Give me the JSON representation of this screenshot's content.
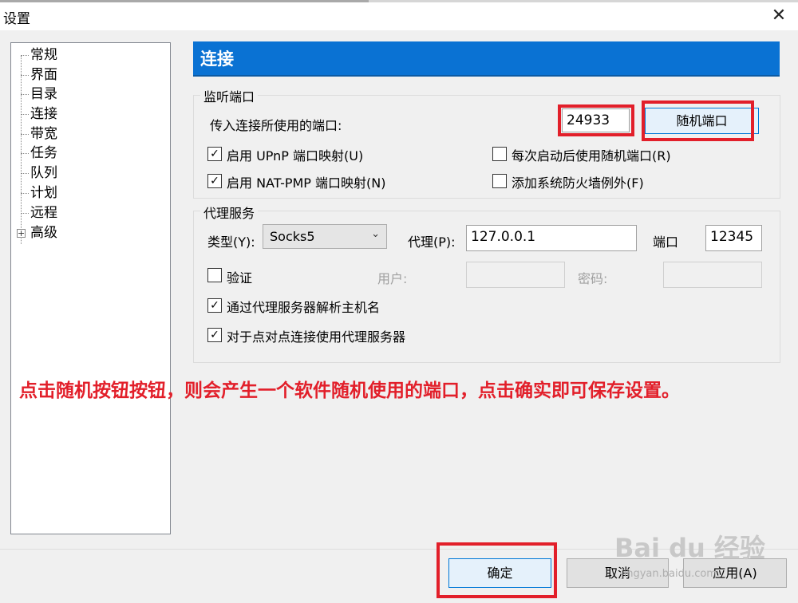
{
  "window": {
    "title": "设置",
    "close_glyph": "✕"
  },
  "sidebar": {
    "items": [
      {
        "label": "常规"
      },
      {
        "label": "界面"
      },
      {
        "label": "目录"
      },
      {
        "label": "连接"
      },
      {
        "label": "带宽"
      },
      {
        "label": "任务"
      },
      {
        "label": "队列"
      },
      {
        "label": "计划"
      },
      {
        "label": "远程"
      },
      {
        "label": "高级",
        "expander": "+"
      }
    ]
  },
  "header": {
    "title": "连接"
  },
  "listen_port": {
    "group_label": "监听端口",
    "incoming_label": "传入连接所使用的端口:",
    "port_value": "24933",
    "random_button": "随机端口",
    "upnp": {
      "label": "启用 UPnP 端口映射(U)",
      "checked": true
    },
    "natpmp": {
      "label": "启用 NAT-PMP 端口映射(N)",
      "checked": true
    },
    "random_each_start": {
      "label": "每次启动后使用随机端口(R)",
      "checked": false
    },
    "firewall": {
      "label": "添加系统防火墙例外(F)",
      "checked": false
    }
  },
  "proxy": {
    "group_label": "代理服务",
    "type_label": "类型(Y):",
    "type_value": "Socks5",
    "proxy_label": "代理(P):",
    "proxy_value": "127.0.0.1",
    "port_label": "端口",
    "port_value": "12345",
    "auth": {
      "label": "验证",
      "checked": false
    },
    "user_label": "用户:",
    "password_label": "密码:",
    "resolve_hostname": {
      "label": "通过代理服务器解析主机名",
      "checked": true
    },
    "p2p_proxy": {
      "label": "对于点对点连接使用代理服务器",
      "checked": true
    }
  },
  "annotation": "点击随机按钮按钮，则会产生一个软件随机使用的端口，点击确实即可保存设置。",
  "footer": {
    "ok": "确定",
    "cancel": "取消",
    "apply": "应用(A)"
  },
  "watermark": {
    "brand": "Bai du 经验",
    "url": "jingyan.baidu.com"
  },
  "colors": {
    "accent": "#0a72d3",
    "annotation_red": "#e21f2a"
  }
}
